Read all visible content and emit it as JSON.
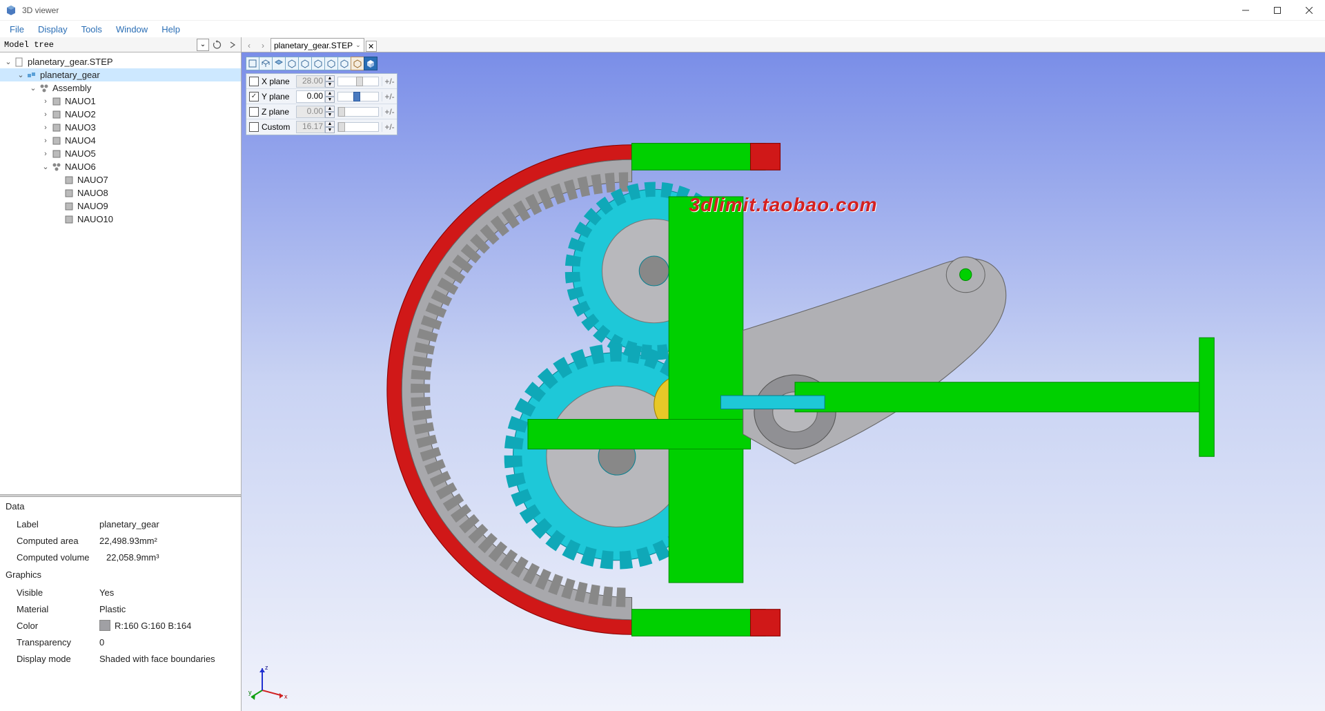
{
  "window": {
    "title": "3D viewer"
  },
  "menu": {
    "items": [
      "File",
      "Display",
      "Tools",
      "Window",
      "Help"
    ]
  },
  "tree": {
    "header": "Model tree",
    "nodes": {
      "root": {
        "label": "planetary_gear.STEP"
      },
      "planetary_gear": {
        "label": "planetary_gear"
      },
      "assembly": {
        "label": "Assembly"
      },
      "nauo1": {
        "label": "NAUO1"
      },
      "nauo2": {
        "label": "NAUO2"
      },
      "nauo3": {
        "label": "NAUO3"
      },
      "nauo4": {
        "label": "NAUO4"
      },
      "nauo5": {
        "label": "NAUO5"
      },
      "nauo6": {
        "label": "NAUO6"
      },
      "nauo7": {
        "label": "NAUO7"
      },
      "nauo8": {
        "label": "NAUO8"
      },
      "nauo9": {
        "label": "NAUO9"
      },
      "nauo10": {
        "label": "NAUO10"
      }
    }
  },
  "properties": {
    "data_title": "Data",
    "graphics_title": "Graphics",
    "label": {
      "name": "Label",
      "value": "planetary_gear"
    },
    "area": {
      "name": "Computed area",
      "value": "22,498.93mm²"
    },
    "volume": {
      "name": "Computed volume",
      "value": "22,058.9mm³"
    },
    "visible": {
      "name": "Visible",
      "value": "Yes"
    },
    "material": {
      "name": "Material",
      "value": "Plastic"
    },
    "color": {
      "name": "Color",
      "value": "R:160 G:160 B:164",
      "hex": "#a0a0a4"
    },
    "transparency": {
      "name": "Transparency",
      "value": "0"
    },
    "display_mode": {
      "name": "Display mode",
      "value": "Shaded with face boundaries"
    }
  },
  "doc_tab": {
    "label": "planetary_gear.STEP"
  },
  "clip": {
    "x": {
      "label": "X plane",
      "value": "28.00",
      "checked": false,
      "slider": 50
    },
    "y": {
      "label": "Y plane",
      "value": "0.00",
      "checked": true,
      "slider": 40
    },
    "z": {
      "label": "Z plane",
      "value": "0.00",
      "checked": false,
      "slider": 0
    },
    "custom": {
      "label": "Custom",
      "value": "16.17",
      "checked": false,
      "slider": 0
    },
    "pm": "+/-"
  },
  "watermark": "3dlimit.taobao.com",
  "axis": {
    "x": "x",
    "y": "y",
    "z": "z"
  }
}
